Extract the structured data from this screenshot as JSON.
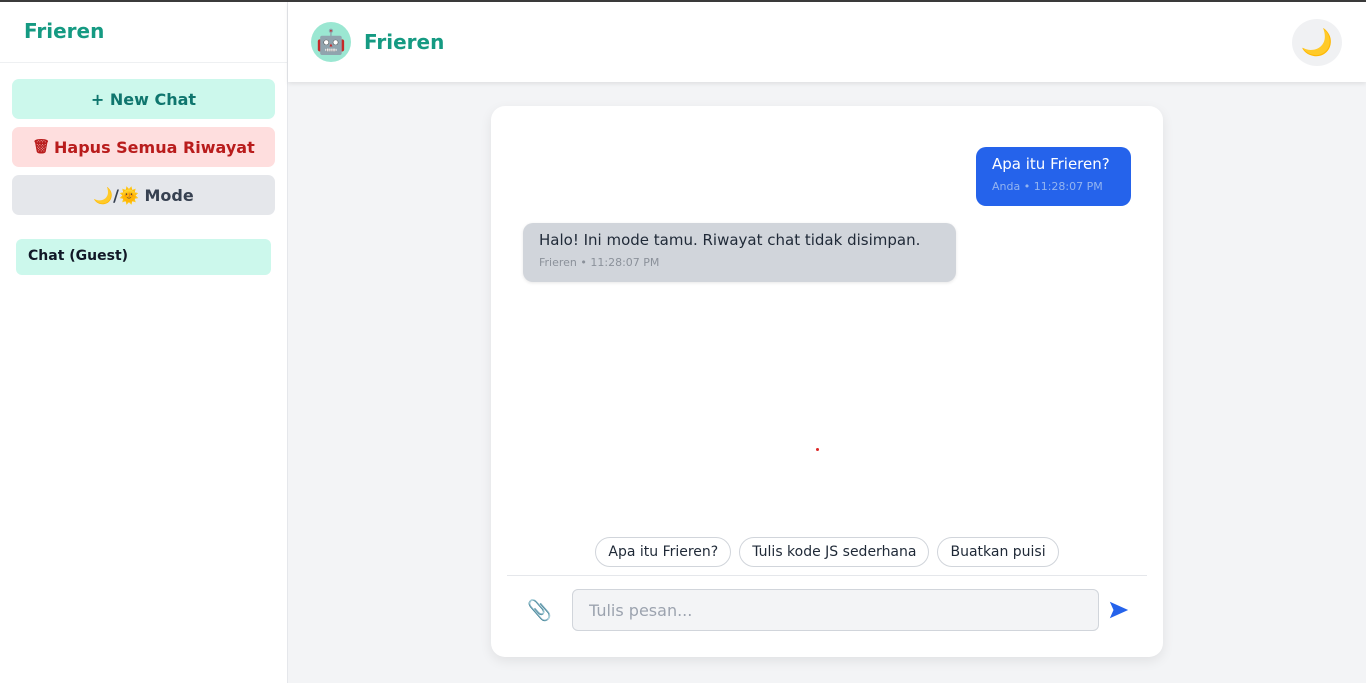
{
  "sidebar": {
    "brand": "Frieren",
    "new_chat_label": "+ New Chat",
    "clear_history_icon": "🗑",
    "clear_history_label": "Hapus Semua Riwayat",
    "mode_label": "🌙/🌞 Mode",
    "chats": [
      {
        "label": "Chat (Guest)"
      }
    ]
  },
  "header": {
    "avatar_icon": "🤖",
    "title": "Frieren",
    "theme_toggle_icon": "🌙"
  },
  "messages": [
    {
      "role": "user",
      "text": "Apa itu Frieren?",
      "meta": "Anda • 11:28:07 PM"
    },
    {
      "role": "bot",
      "text": "Halo! Ini mode tamu. Riwayat chat tidak disimpan.",
      "meta": "Frieren • 11:28:07 PM"
    }
  ],
  "suggestions": [
    "Apa itu Frieren?",
    "Tulis kode JS sederhana",
    "Buatkan puisi"
  ],
  "composer": {
    "attach_icon": "📎",
    "placeholder": "Tulis pesan...",
    "value": ""
  },
  "colors": {
    "brand": "#159a82",
    "user_bubble": "#2563eb",
    "bot_bubble": "#d1d5db",
    "send": "#2563eb"
  }
}
